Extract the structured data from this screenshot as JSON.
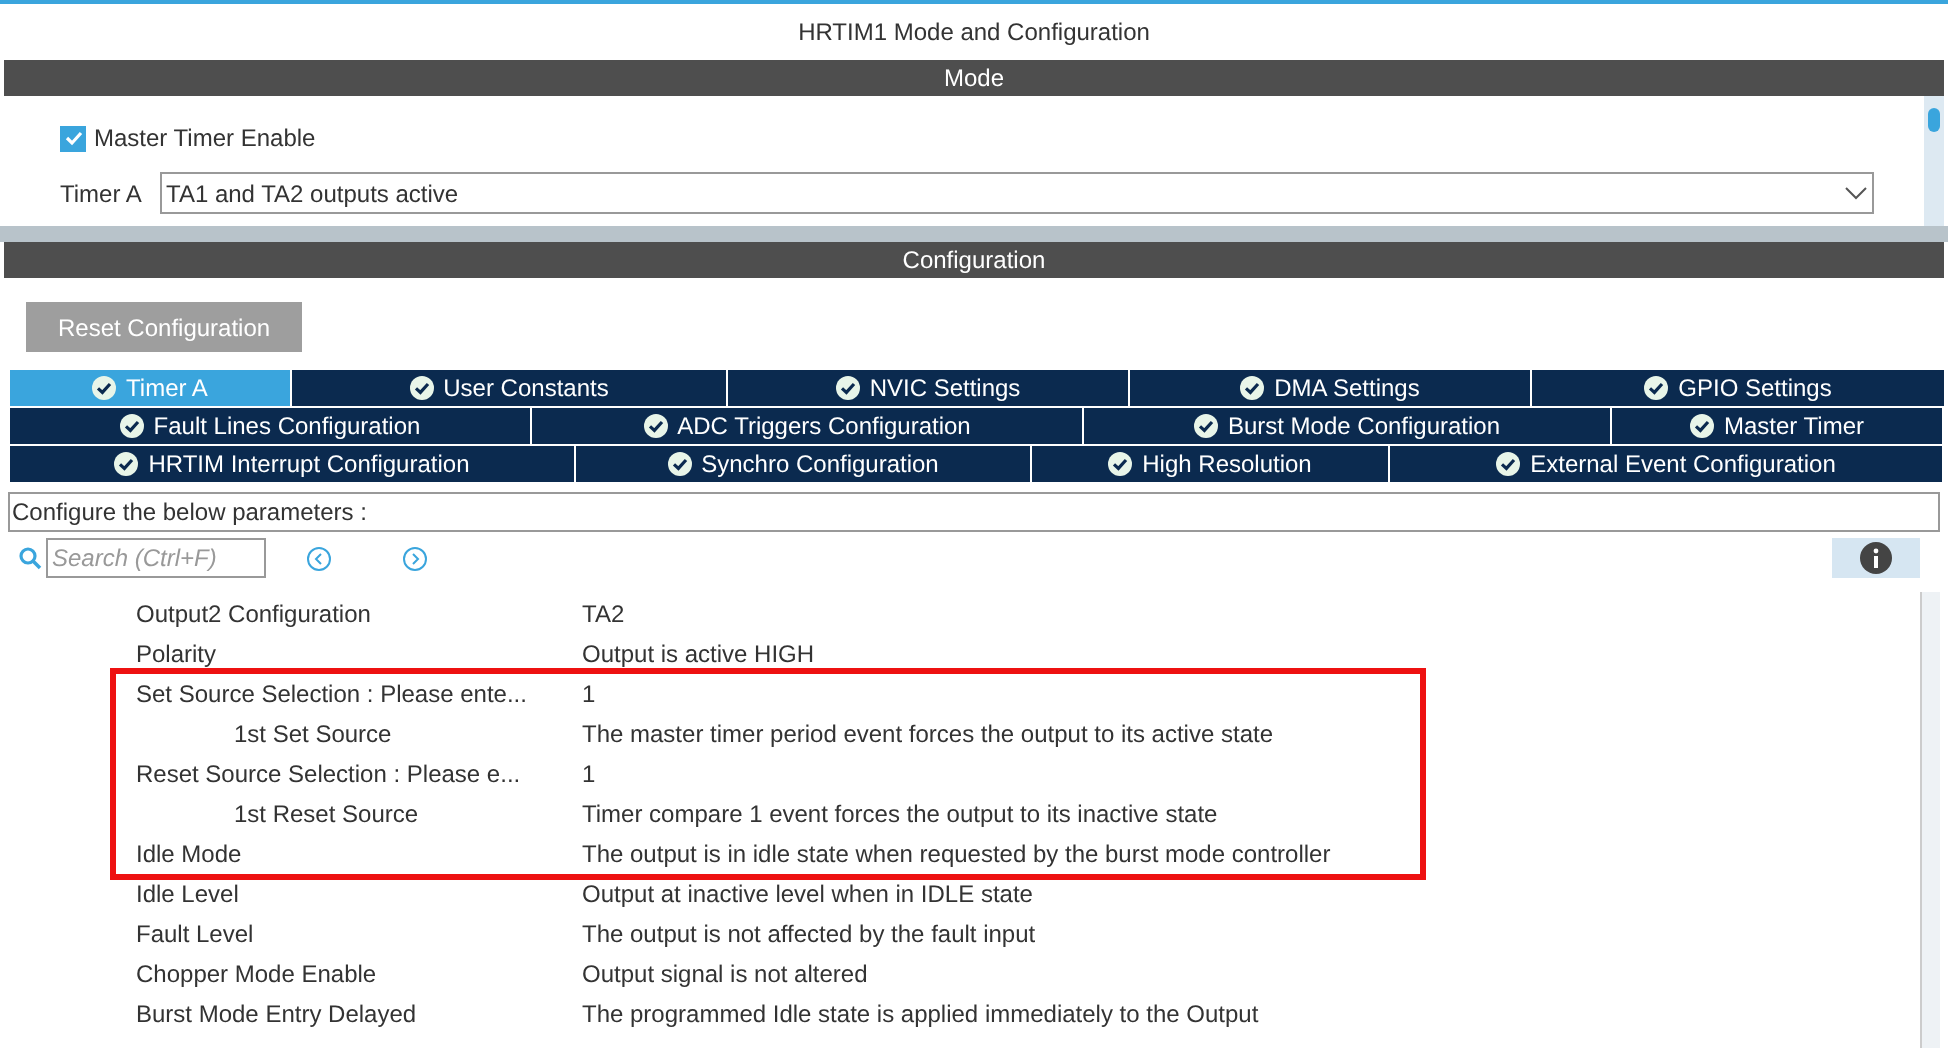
{
  "window": {
    "title": "HRTIM1 Mode and Configuration"
  },
  "mode": {
    "header": "Mode",
    "master_timer": {
      "label": "Master Timer Enable",
      "checked": true
    },
    "timer_a": {
      "label": "Timer A",
      "value": "TA1 and TA2 outputs active"
    }
  },
  "configuration": {
    "header": "Configuration",
    "reset_button": "Reset Configuration",
    "tab_rows": [
      [
        {
          "label": "Timer A",
          "selected": true
        },
        {
          "label": "User Constants",
          "selected": false
        },
        {
          "label": "NVIC Settings",
          "selected": false
        },
        {
          "label": "DMA Settings",
          "selected": false
        },
        {
          "label": "GPIO Settings",
          "selected": false
        }
      ],
      [
        {
          "label": "Fault Lines Configuration",
          "selected": false
        },
        {
          "label": "ADC Triggers Configuration",
          "selected": false
        },
        {
          "label": "Burst Mode Configuration",
          "selected": false
        },
        {
          "label": "Master Timer",
          "selected": false
        }
      ],
      [
        {
          "label": "HRTIM Interrupt Configuration",
          "selected": false
        },
        {
          "label": "Synchro Configuration",
          "selected": false
        },
        {
          "label": "High Resolution",
          "selected": false
        },
        {
          "label": "External Event Configuration",
          "selected": false
        }
      ]
    ],
    "hint": "Configure the below parameters :",
    "search": {
      "placeholder": "Search (Ctrl+F)"
    },
    "parameters": [
      {
        "name": "Output2 Configuration",
        "value": "TA2",
        "highlighted": false
      },
      {
        "name": "Polarity",
        "value": "Output is active HIGH",
        "highlighted": false
      },
      {
        "name": "Set Source  Selection : Please ente...",
        "value": "1",
        "highlighted": true,
        "children": [
          {
            "name": "1st Set Source",
            "value": "The master timer period event forces the output to its active state"
          }
        ]
      },
      {
        "name": "Reset Source  Selection : Please e...",
        "value": "1",
        "highlighted": true,
        "children": [
          {
            "name": "1st Reset Source",
            "value": "Timer compare 1 event forces the output to its inactive state"
          }
        ]
      },
      {
        "name": "Idle Mode",
        "value": "The output is in idle state when requested by the burst mode controller",
        "highlighted": true
      },
      {
        "name": "Idle Level",
        "value": "Output at inactive level when in IDLE state",
        "highlighted": false
      },
      {
        "name": "Fault Level",
        "value": "The output is not affected by the fault input",
        "highlighted": false
      },
      {
        "name": "Chopper Mode Enable",
        "value": "Output signal is not altered",
        "highlighted": false
      },
      {
        "name": "Burst Mode Entry Delayed",
        "value": "The programmed Idle state is applied immediately to the Output",
        "highlighted": false
      }
    ]
  }
}
